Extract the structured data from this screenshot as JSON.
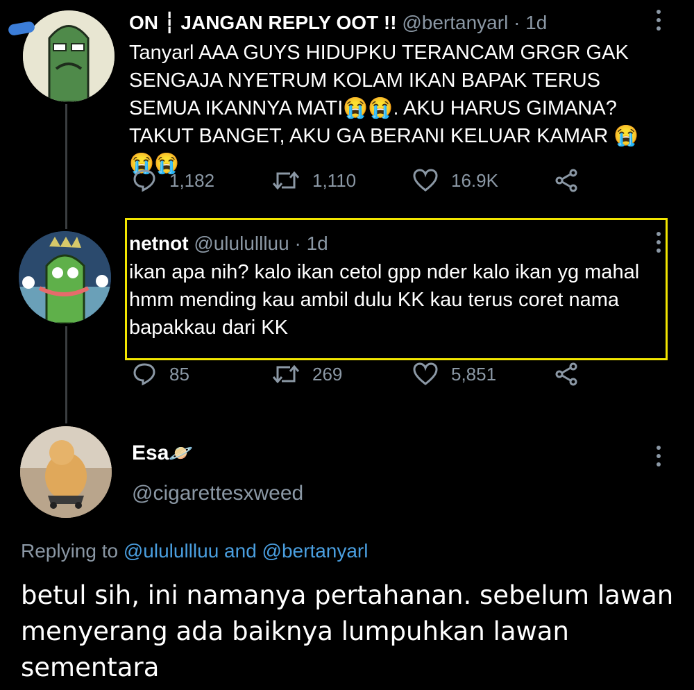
{
  "tweet1": {
    "name": "ON ┆ JANGAN REPLY OOT !!",
    "handle": "@bertanyarl",
    "time": "· 1d",
    "text": "Tanyarl AAA GUYS HIDUPKU TERANCAM GRGR GAK SENGAJA NYETRUM KOLAM IKAN BAPAK TERUS SEMUA IKANNYA MATI😭😭. AKU HARUS GIMANA? TAKUT BANGET, AKU GA BERANI KELUAR KAMAR 😭😭😭",
    "replies": "1,182",
    "retweets": "1,110",
    "likes": "16.9K"
  },
  "tweet2": {
    "name": "netnot",
    "handle": "@ululullluu",
    "time": "· 1d",
    "text": "ikan apa nih? kalo ikan cetol gpp nder kalo ikan yg mahal hmm mending kau ambil dulu KK kau terus coret nama bapakkau dari KK",
    "replies": "85",
    "retweets": "269",
    "likes": "5,851"
  },
  "tweet3": {
    "name": "Esa",
    "name_emoji": "🪐",
    "handle": "@cigarettesxweed",
    "replying_prefix": "Replying to",
    "replying_user1": "@ululullluu",
    "replying_and": "and",
    "replying_user2": "@bertanyarl",
    "text": "betul sih, ini namanya pertahanan. sebelum lawan menyerang ada baiknya lumpuhkan lawan sementara"
  },
  "colors": {
    "background": "#000000",
    "muted": "#8b98a5",
    "link": "#4a9fe0",
    "highlight": "#f2e600"
  },
  "icons": [
    "reply-icon",
    "retweet-icon",
    "like-icon",
    "share-icon",
    "more-icon"
  ]
}
